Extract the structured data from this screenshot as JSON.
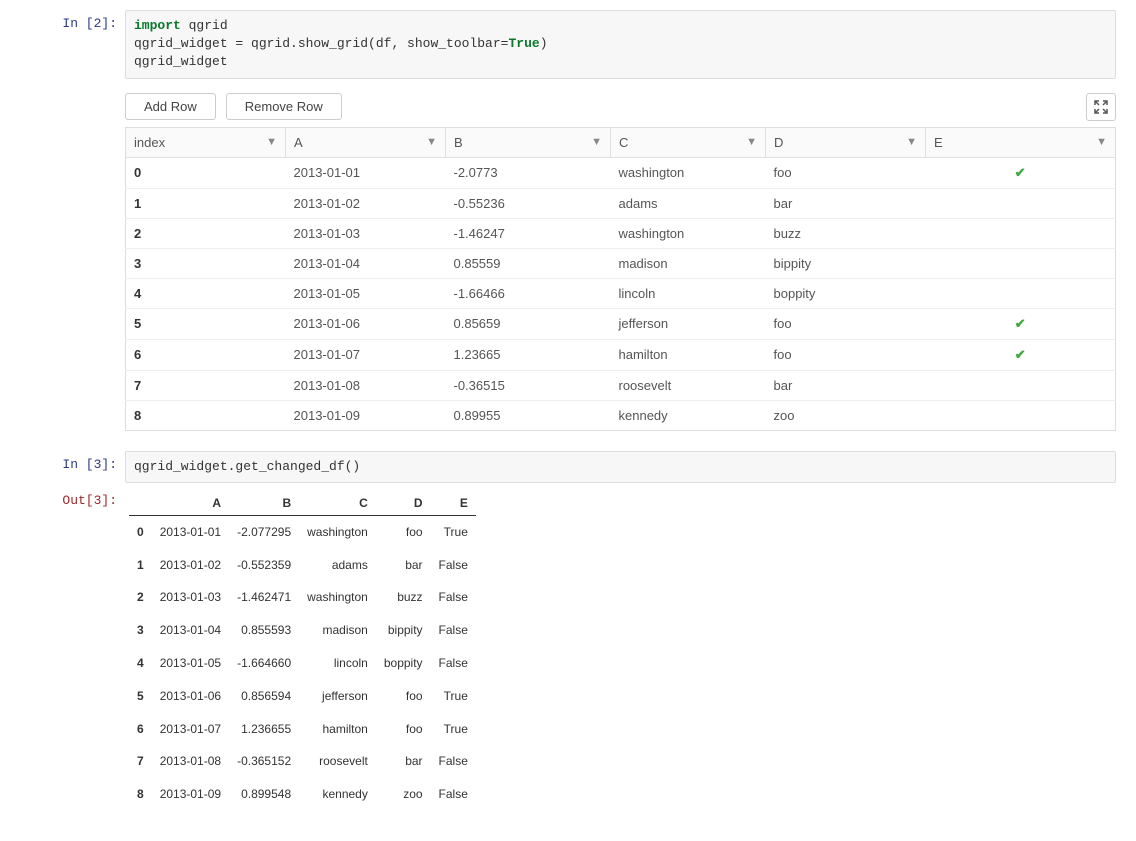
{
  "cell2": {
    "prompt": "In [2]:",
    "code": {
      "kw_import": "import",
      "pkg": " qgrid",
      "line2a": "qgrid_widget = qgrid.show_grid(df, show_toolbar=",
      "bool": "True",
      "line2b": ")",
      "line3": "qgrid_widget"
    },
    "toolbar": {
      "add_row": "Add Row",
      "remove_row": "Remove Row"
    },
    "headers": {
      "index": "index",
      "A": "A",
      "B": "B",
      "C": "C",
      "D": "D",
      "E": "E"
    },
    "rows": [
      {
        "index": "0",
        "A": "2013-01-01",
        "B": "-2.0773",
        "C": "washington",
        "D": "foo",
        "E": true
      },
      {
        "index": "1",
        "A": "2013-01-02",
        "B": "-0.55236",
        "C": "adams",
        "D": "bar",
        "E": false
      },
      {
        "index": "2",
        "A": "2013-01-03",
        "B": "-1.46247",
        "C": "washington",
        "D": "buzz",
        "E": false
      },
      {
        "index": "3",
        "A": "2013-01-04",
        "B": "0.85559",
        "C": "madison",
        "D": "bippity",
        "E": false
      },
      {
        "index": "4",
        "A": "2013-01-05",
        "B": "-1.66466",
        "C": "lincoln",
        "D": "boppity",
        "E": false
      },
      {
        "index": "5",
        "A": "2013-01-06",
        "B": "0.85659",
        "C": "jefferson",
        "D": "foo",
        "E": true
      },
      {
        "index": "6",
        "A": "2013-01-07",
        "B": "1.23665",
        "C": "hamilton",
        "D": "foo",
        "E": true
      },
      {
        "index": "7",
        "A": "2013-01-08",
        "B": "-0.36515",
        "C": "roosevelt",
        "D": "bar",
        "E": false
      },
      {
        "index": "8",
        "A": "2013-01-09",
        "B": "0.89955",
        "C": "kennedy",
        "D": "zoo",
        "E": false
      }
    ]
  },
  "cell3": {
    "prompt_in": "In [3]:",
    "prompt_out": "Out[3]:",
    "code": "qgrid_widget.get_changed_df()",
    "headers": [
      "A",
      "B",
      "C",
      "D",
      "E"
    ],
    "rows": [
      {
        "idx": "0",
        "A": "2013-01-01",
        "B": "-2.077295",
        "C": "washington",
        "D": "foo",
        "E": "True"
      },
      {
        "idx": "1",
        "A": "2013-01-02",
        "B": "-0.552359",
        "C": "adams",
        "D": "bar",
        "E": "False"
      },
      {
        "idx": "2",
        "A": "2013-01-03",
        "B": "-1.462471",
        "C": "washington",
        "D": "buzz",
        "E": "False"
      },
      {
        "idx": "3",
        "A": "2013-01-04",
        "B": "0.855593",
        "C": "madison",
        "D": "bippity",
        "E": "False"
      },
      {
        "idx": "4",
        "A": "2013-01-05",
        "B": "-1.664660",
        "C": "lincoln",
        "D": "boppity",
        "E": "False"
      },
      {
        "idx": "5",
        "A": "2013-01-06",
        "B": "0.856594",
        "C": "jefferson",
        "D": "foo",
        "E": "True"
      },
      {
        "idx": "6",
        "A": "2013-01-07",
        "B": "1.236655",
        "C": "hamilton",
        "D": "foo",
        "E": "True"
      },
      {
        "idx": "7",
        "A": "2013-01-08",
        "B": "-0.365152",
        "C": "roosevelt",
        "D": "bar",
        "E": "False"
      },
      {
        "idx": "8",
        "A": "2013-01-09",
        "B": "0.899548",
        "C": "kennedy",
        "D": "zoo",
        "E": "False"
      }
    ]
  }
}
